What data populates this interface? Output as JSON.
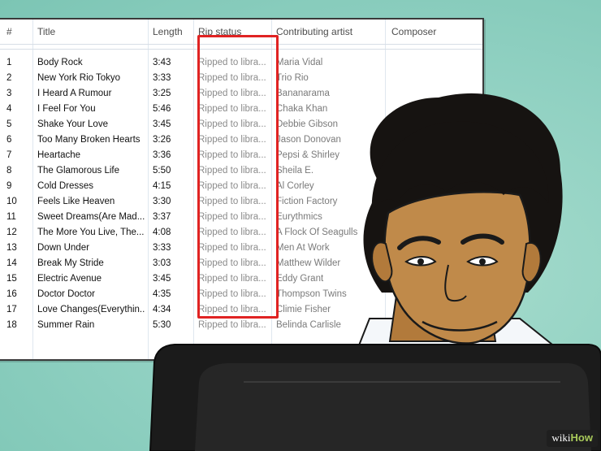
{
  "table": {
    "headers": {
      "num": "#",
      "title": "Title",
      "length": "Length",
      "rip_status": "Rip status",
      "artist": "Contributing artist",
      "composer": "Composer"
    },
    "rows": [
      {
        "num": "1",
        "title": "Body Rock",
        "length": "3:43",
        "rip": "Ripped to libra...",
        "artist": "Maria Vidal"
      },
      {
        "num": "2",
        "title": "New York Rio Tokyo",
        "length": "3:33",
        "rip": "Ripped to libra...",
        "artist": "Trio Rio"
      },
      {
        "num": "3",
        "title": "I Heard A Rumour",
        "length": "3:25",
        "rip": "Ripped to libra...",
        "artist": "Bananarama"
      },
      {
        "num": "4",
        "title": "I Feel For You",
        "length": "5:46",
        "rip": "Ripped to libra...",
        "artist": "Chaka Khan"
      },
      {
        "num": "5",
        "title": "Shake Your Love",
        "length": "3:45",
        "rip": "Ripped to libra...",
        "artist": "Debbie Gibson"
      },
      {
        "num": "6",
        "title": "Too Many Broken Hearts",
        "length": "3:26",
        "rip": "Ripped to libra...",
        "artist": "Jason Donovan"
      },
      {
        "num": "7",
        "title": "Heartache",
        "length": "3:36",
        "rip": "Ripped to libra...",
        "artist": "Pepsi & Shirley"
      },
      {
        "num": "8",
        "title": "The Glamorous Life",
        "length": "5:50",
        "rip": "Ripped to libra...",
        "artist": "Sheila E."
      },
      {
        "num": "9",
        "title": "Cold Dresses",
        "length": "4:15",
        "rip": "Ripped to libra...",
        "artist": "Al Corley"
      },
      {
        "num": "10",
        "title": "Feels Like Heaven",
        "length": "3:30",
        "rip": "Ripped to libra...",
        "artist": "Fiction Factory"
      },
      {
        "num": "11",
        "title": "Sweet Dreams(Are Mad...",
        "length": "3:37",
        "rip": "Ripped to libra...",
        "artist": "Eurythmics"
      },
      {
        "num": "12",
        "title": "The More You Live, The...",
        "length": "4:08",
        "rip": "Ripped to libra...",
        "artist": "A Flock Of Seagulls"
      },
      {
        "num": "13",
        "title": "Down Under",
        "length": "3:33",
        "rip": "Ripped to libra...",
        "artist": "Men At Work"
      },
      {
        "num": "14",
        "title": "Break My Stride",
        "length": "3:03",
        "rip": "Ripped to libra...",
        "artist": "Matthew Wilder"
      },
      {
        "num": "15",
        "title": "Electric Avenue",
        "length": "3:45",
        "rip": "Ripped to libra...",
        "artist": "Eddy Grant"
      },
      {
        "num": "16",
        "title": "Doctor Doctor",
        "length": "4:35",
        "rip": "Ripped to libra...",
        "artist": "Thompson Twins"
      },
      {
        "num": "17",
        "title": "Love Changes(Everythin...",
        "length": "4:34",
        "rip": "Ripped to libra...",
        "artist": "Climie Fisher"
      },
      {
        "num": "18",
        "title": "Summer Rain",
        "length": "5:30",
        "rip": "Ripped to libra...",
        "artist": "Belinda Carlisle"
      }
    ]
  },
  "highlight_color": "#e02323",
  "background_color": "#8fd0c1",
  "logo": {
    "wiki": "wiki",
    "how": "How"
  }
}
